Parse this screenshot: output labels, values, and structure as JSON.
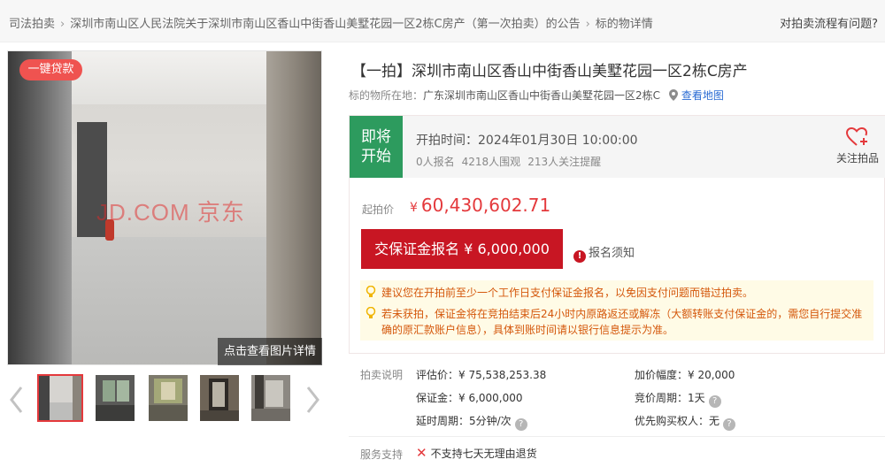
{
  "breadcrumb": {
    "items": [
      "司法拍卖",
      "深圳市南山区人民法院关于深圳市南山区香山中街香山美墅花园一区2栋C房产（第一次拍卖）的公告",
      "标的物详情"
    ],
    "separator": "›"
  },
  "help_link": "对拍卖流程有问题?",
  "gallery": {
    "loan_badge": "一键贷款",
    "watermark": "JD.COM 京东",
    "view_detail": "点击查看图片详情",
    "prev_icon": "chevron-left-icon",
    "next_icon": "chevron-right-icon"
  },
  "item": {
    "title": "【一拍】深圳市南山区香山中街香山美墅花园一区2栋C房产",
    "location_label": "标的物所在地：",
    "location_value": "广东深圳市南山区香山中街香山美墅花园一区2栋C",
    "map_link": "查看地图"
  },
  "status": {
    "badge_line1": "即将",
    "badge_line2": "开始",
    "start_time": "开拍时间：2024年01月30日 10:00:00",
    "signups": "0人报名",
    "views": "4218人围观",
    "reminders": "213人关注提醒",
    "follow_label": "关注拍品"
  },
  "price": {
    "label": "起拍价",
    "currency": "¥",
    "value": "60,430,602.71"
  },
  "actions": {
    "signup_button": "交保证金报名 ¥ 6,000,000",
    "notice_link": "报名须知"
  },
  "tips": [
    "建议您在开拍前至少一个工作日支付保证金报名，以免因支付问题而错过拍卖。",
    "若未获拍，保证金将在竞拍结束后24小时内原路返还或解冻（大额转账支付保证金的，需您自行提交准",
    "确的原汇款账户信息），具体到账时间请以银行信息提示为准。"
  ],
  "auction_info": {
    "section_label": "拍卖说明",
    "appraisal": "评估价：¥ 75,538,253.38",
    "deposit": "保证金：¥ 6,000,000",
    "delay": "延时周期：5分钟/次",
    "increment": "加价幅度：¥ 20,000",
    "bid_cycle": "竞价周期：1天",
    "preemption": "优先购买权人：无"
  },
  "service": {
    "label": "服务支持",
    "no_return": "不支持七天无理由退货"
  },
  "colors": {
    "brand_red": "#e4393c",
    "button_red": "#c81623",
    "status_green": "#2d9b5e",
    "tip_orange": "#d4570b",
    "link_blue": "#2a6bd3"
  }
}
